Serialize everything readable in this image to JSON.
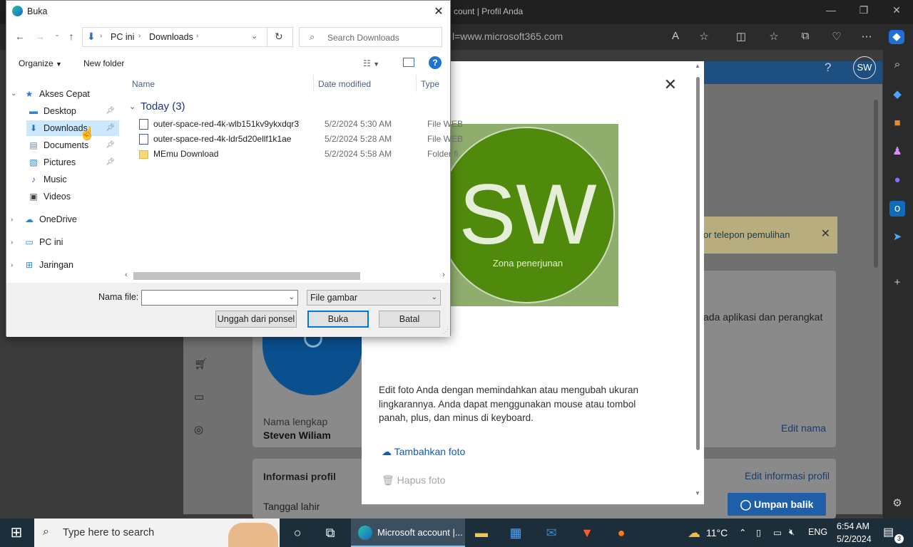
{
  "edge": {
    "title": "count | Profil Anda",
    "url": "l=www.microsoft365.com",
    "header_avatar": "SW",
    "header_help": "?"
  },
  "profile_page": {
    "notice_text": "or telepon pemulihan",
    "notice_line2": "ada aplikasi dan perangkat",
    "full_name_label": "Nama lengkap",
    "full_name_value": "Steven Wiliam",
    "edit_name": "Edit nama",
    "profile_info_title": "Informasi profil",
    "edit_profile_info": "Edit informasi profil",
    "birth_date_label": "Tanggal lahir",
    "feedback_button": "Umpan balik"
  },
  "photo_modal": {
    "initials": "SW",
    "photo_caption": "Zona penerjunan",
    "description": "Edit foto Anda dengan memindahkan atau mengubah ukuran lingkarannya. Anda dapat menggunakan mouse atau tombol panah, plus, dan minus di keyboard.",
    "add_photo": "Tambahkan foto",
    "remove_photo": "Hapus foto"
  },
  "dialog": {
    "title": "Buka",
    "breadcrumb": [
      "PC ini",
      "Downloads"
    ],
    "search_placeholder": "Search Downloads",
    "organize": "Organize",
    "new_folder": "New folder",
    "nav": {
      "quick_access": "Akses Cepat",
      "items": [
        {
          "label": "Desktop",
          "icon": "desktop-icon",
          "pinned": true
        },
        {
          "label": "Downloads",
          "icon": "download-arrow-icon",
          "pinned": true,
          "selected": true
        },
        {
          "label": "Documents",
          "icon": "document-icon",
          "pinned": true
        },
        {
          "label": "Pictures",
          "icon": "pictures-icon",
          "pinned": true
        },
        {
          "label": "Music",
          "icon": "music-icon",
          "pinned": false
        },
        {
          "label": "Videos",
          "icon": "video-icon",
          "pinned": false
        }
      ],
      "onedrive": "OneDrive",
      "pc": "PC ini",
      "network": "Jaringan"
    },
    "columns": {
      "name": "Name",
      "date": "Date modified",
      "type": "Type"
    },
    "group": "Today (3)",
    "files": [
      {
        "name": "outer-space-red-4k-wlb151kv9ykxdqr3",
        "date": "5/2/2024 5:30 AM",
        "type": "File WEB"
      },
      {
        "name": "outer-space-red-4k-ldr5d20ellf1k1ae",
        "date": "5/2/2024 5:28 AM",
        "type": "File WEB"
      },
      {
        "name": "MEmu Download",
        "date": "5/2/2024 5:58 AM",
        "type": "Folder fi"
      }
    ],
    "filename_label": "Nama file:",
    "filename_value": "",
    "filter": "File gambar",
    "btn_upload": "Unggah dari ponsel",
    "btn_open": "Buka",
    "btn_cancel": "Batal"
  },
  "taskbar": {
    "search_placeholder": "Type here to search",
    "active_app": "Microsoft account |...",
    "temperature": "11°C",
    "language": "ENG",
    "time": "6:54 AM",
    "date": "5/2/2024",
    "notifications": "3"
  },
  "colors": {
    "accent": "#0078d7",
    "avatar_green": "#4f8a0c",
    "selection": "#cce8ff",
    "taskbar": "#1c2e3a"
  }
}
